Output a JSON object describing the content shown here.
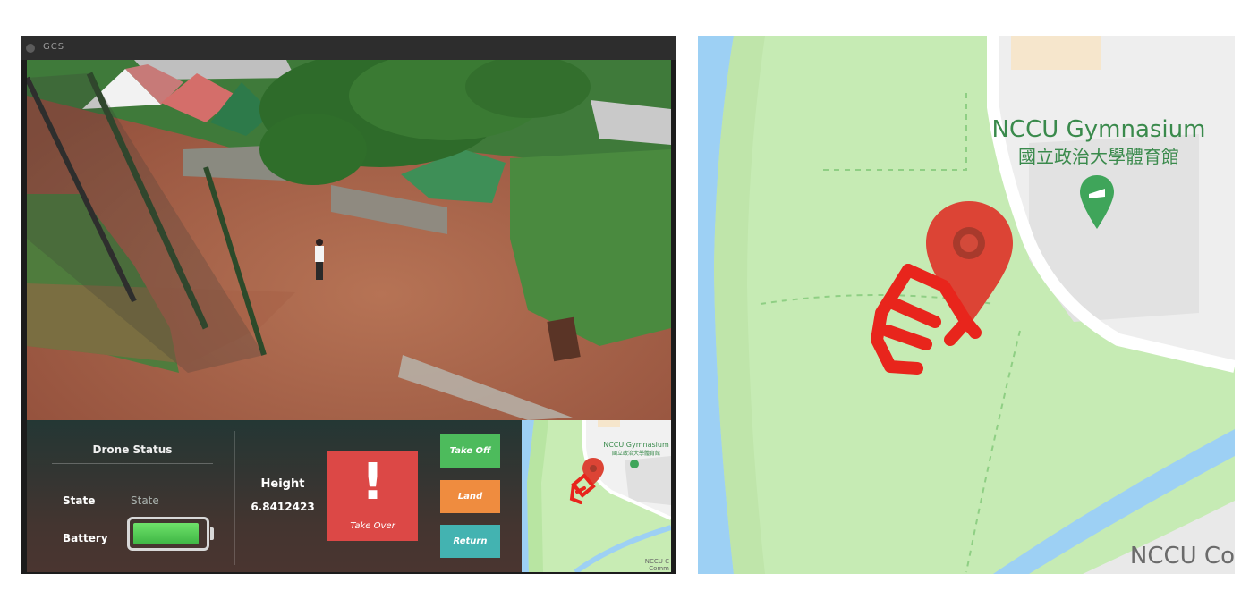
{
  "window": {
    "title": "GCS"
  },
  "panel": {
    "drone_status_title": "Drone Status",
    "state_label": "State",
    "state_value": "State",
    "battery_label": "Battery",
    "battery_level": 0.94,
    "height_label": "Height",
    "height_value": "6.8412423"
  },
  "buttons": {
    "take_over": "Take Over",
    "take_over_icon": "!",
    "take_off": "Take Off",
    "land": "Land",
    "return": "Return"
  },
  "minimap": {
    "poi_name_en": "NCCU Gymnasium",
    "poi_name_zh": "國立政治大學體育館",
    "edge_label_1": "NCCU C",
    "edge_label_2": "Comm"
  },
  "map": {
    "poi_name_en": "NCCU Gymnasium",
    "poi_name_zh": "國立政治大學體育館",
    "edge_label": "NCCU Co"
  },
  "colors": {
    "take_over": "#dc4846",
    "take_off": "#4dbb5c",
    "land": "#ef8c3f",
    "return": "#43b3b1",
    "battery": "#4fc84f",
    "marker": "#dc4435",
    "drone_icon": "#e8251c",
    "park": "#c6ebb4",
    "water": "#9dd0f4"
  },
  "icons": {
    "location_marker": "map-pin-icon",
    "drone": "drone-icon",
    "gym_poi": "gym-poi-icon"
  }
}
